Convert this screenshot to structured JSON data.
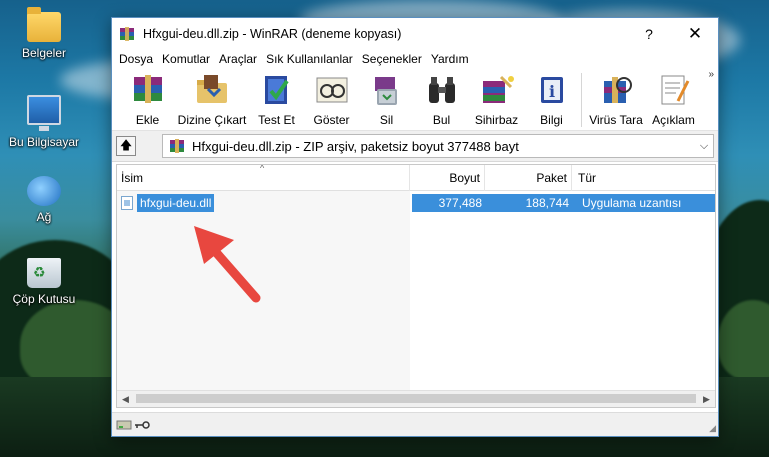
{
  "desktop": {
    "icons": [
      {
        "label": "Belgeler",
        "icon": "documents-folder-icon"
      },
      {
        "label": "Bu Bilgisayar",
        "icon": "this-pc-icon"
      },
      {
        "label": "Ağ",
        "icon": "network-icon"
      },
      {
        "label": "Çöp Kutusu",
        "icon": "recycle-bin-icon"
      }
    ]
  },
  "window": {
    "title": "Hfxgui-deu.dll.zip - WinRAR (deneme kopyası)",
    "help_glyph": "?",
    "close_glyph": "✕"
  },
  "menu": {
    "items": [
      "Dosya",
      "Komutlar",
      "Araçlar",
      "Sık Kullanılanlar",
      "Seçenekler",
      "Yardım"
    ]
  },
  "toolbar": {
    "buttons": [
      {
        "label": "Ekle",
        "icon": "add-archive-icon"
      },
      {
        "label": "Dizine Çıkart",
        "icon": "extract-to-icon"
      },
      {
        "label": "Test Et",
        "icon": "test-icon"
      },
      {
        "label": "Göster",
        "icon": "view-icon"
      },
      {
        "label": "Sil",
        "icon": "delete-icon"
      },
      {
        "label": "Bul",
        "icon": "find-icon"
      },
      {
        "label": "Sihirbaz",
        "icon": "wizard-icon"
      },
      {
        "label": "Bilgi",
        "icon": "info-icon"
      },
      {
        "label": "Virüs Tara",
        "icon": "virus-scan-icon"
      },
      {
        "label": "Açıklam",
        "icon": "comment-icon"
      }
    ],
    "more_glyph": "»"
  },
  "address": {
    "text": "Hfxgui-deu.dll.zip - ZIP arşiv, paketsiz boyut 377488 bayt",
    "up_glyph": "🡅",
    "dropdown_glyph": "⌵"
  },
  "list": {
    "columns": {
      "name": "İsim",
      "size": "Boyut",
      "packed": "Paket",
      "type": "Tür"
    },
    "sort_glyph": "^",
    "rows": [
      {
        "name": "hfxgui-deu.dll",
        "size": "377,488",
        "packed": "188,744",
        "type": "Uygulama uzantısı",
        "selected": true
      }
    ]
  },
  "colors": {
    "selection": "#3a8fdb",
    "annotation_arrow": "#e8473f",
    "window_border": "#5a8fc0"
  }
}
